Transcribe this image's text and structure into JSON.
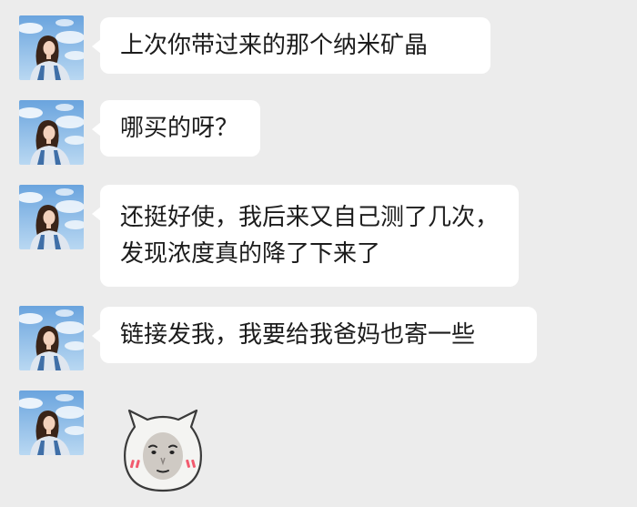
{
  "chat": {
    "messages": [
      {
        "sender": "friend",
        "avatar_icon": "woman-sky-avatar-icon",
        "text": "上次你带过来的那个纳米矿晶"
      },
      {
        "sender": "friend",
        "avatar_icon": "woman-sky-avatar-icon",
        "text": "哪买的呀？"
      },
      {
        "sender": "friend",
        "avatar_icon": "woman-sky-avatar-icon",
        "text": "还挺好使，我后来又自己测了几次，发现浓度真的降了下来了"
      },
      {
        "sender": "friend",
        "avatar_icon": "woman-sky-avatar-icon",
        "text": "链接发我，我要给我爸妈也寄一些"
      },
      {
        "sender": "friend",
        "avatar_icon": "woman-sky-avatar-icon",
        "sticker": "shy-blushing-face-sticker"
      }
    ]
  },
  "colors": {
    "background": "#ececec",
    "bubble": "#ffffff",
    "text": "#1c1c1c"
  }
}
